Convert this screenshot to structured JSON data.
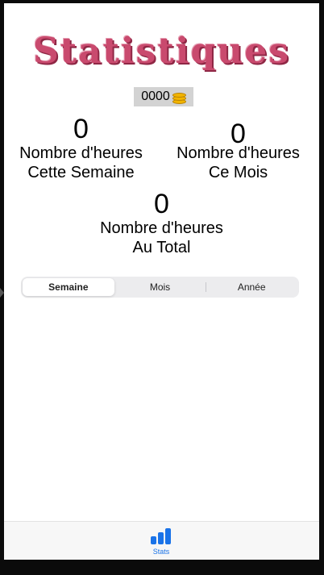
{
  "header": {
    "title": "Statistiques",
    "title_color": "#c94a6e"
  },
  "coins": {
    "value": "0000",
    "icon": "coins-icon"
  },
  "stats": {
    "week": {
      "value": "0",
      "label_line1": "Nombre d'heures",
      "label_line2": "Cette Semaine"
    },
    "month": {
      "value": "0",
      "label_line1": "Nombre d'heures",
      "label_line2": "Ce Mois"
    },
    "total": {
      "value": "0",
      "label_line1": "Nombre d'heures",
      "label_line2": "Au Total"
    }
  },
  "segmented_control": {
    "options": [
      "Semaine",
      "Mois",
      "Année"
    ],
    "selected": "Semaine"
  },
  "tabbar": {
    "tabs": [
      {
        "label": "Stats",
        "icon": "bar-chart-icon",
        "active": true,
        "color": "#1a73e8"
      }
    ]
  }
}
